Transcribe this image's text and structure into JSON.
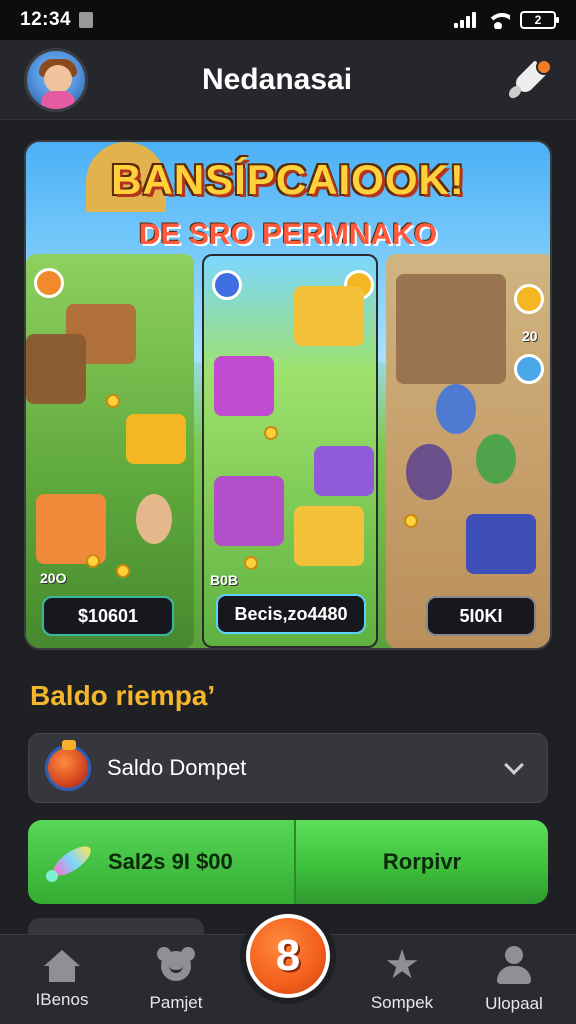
{
  "status_bar": {
    "time": "12:34",
    "battery": "2"
  },
  "header": {
    "title": "Nedanasai"
  },
  "banner": {
    "title": "BANSÍPCAIOOK!",
    "subtitle": "DE SRO PERMNAKO",
    "panels": [
      {
        "small_value": "20O",
        "price": "$10601"
      },
      {
        "small_value": "B0B",
        "price": "Becis,zo4480"
      },
      {
        "small_value": "20",
        "price": "5I0KI"
      }
    ]
  },
  "section": {
    "title": "Baldo riempa’"
  },
  "wallet_select": {
    "label": "Saldo Dompet"
  },
  "action_bar": {
    "amount": "Sal2s 9I $00",
    "action_label": "Rorpivr"
  },
  "bottom_nav": {
    "items": [
      {
        "label": "IBenos",
        "icon": "home-icon"
      },
      {
        "label": "Pamjet",
        "icon": "bear-icon"
      },
      {
        "label": "Sompek",
        "icon": "star-icon"
      },
      {
        "label": "Ulopaal",
        "icon": "user-icon"
      }
    ],
    "center_button": "8"
  },
  "colors": {
    "accent_orange": "#f25e1d",
    "section_title": "#f4b62d",
    "action_green": "#3bbd3a",
    "background": "#1f2024"
  }
}
